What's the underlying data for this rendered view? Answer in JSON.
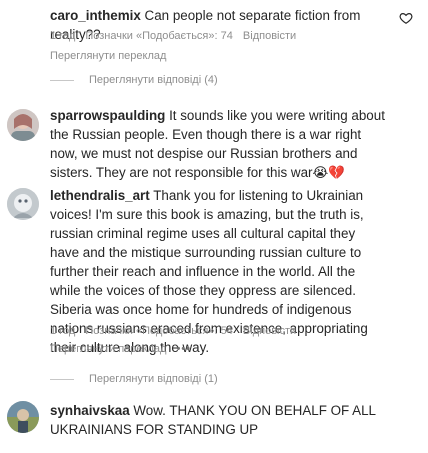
{
  "comments": [
    {
      "username": "caro_inthemix",
      "text": "Can people not separate fiction from reality??",
      "time": "1 год",
      "likes": "Позначки «Подобається»: 74",
      "reply": "Відповісти",
      "translate": "Переглянути переклад",
      "view_replies": "Переглянути відповіді (4)"
    },
    {
      "username": "sparrowspaulding",
      "text": "It sounds like you were writing about the Russian people. Even though there is a war right now, we must not despise our Russian brothers and sisters. They are not responsible for this war😭💔"
    },
    {
      "username": "lethendralis_art",
      "text": "Thank you for listening to Ukrainian voices! I'm sure this book is amazing, but the truth is, russian criminal regime uses all cultural capital they have and the mistique surrounding russian culture to further their reach and influence in the world. All the while the voices of those they oppress are silenced. Siberia was once home for hundreds of indigenous nations russians eraced from existence, appropriating their culture along the way.",
      "time": "1 год",
      "likes": "Позначки «Подобається»: 54",
      "reply": "Відповісти",
      "translate": "Переглянути переклад",
      "more": "•••",
      "view_replies": "Переглянути відповіді (1)"
    },
    {
      "username": "synhaivskaa",
      "text": "Wow. THANK YOU ON BEHALF OF ALL UKRAINIANS FOR STANDING UP"
    }
  ]
}
